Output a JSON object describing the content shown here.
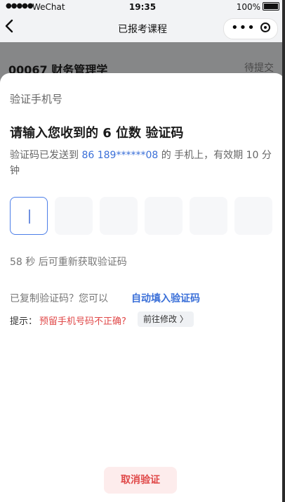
{
  "statusbar": {
    "signal": "●●●●●",
    "carrier": "WeChat",
    "time": "19:35",
    "battery": "100%"
  },
  "navbar": {
    "title": "已报考课程",
    "back_icon": "chevron-left-icon",
    "more_icon": "ellipsis-icon",
    "close_icon": "target-circle-icon"
  },
  "background": {
    "course_title": "00067 财务管理学",
    "status": "待提交"
  },
  "sheet": {
    "title": "验证手机号",
    "heading": "请输入您收到的 6 位数 验证码",
    "sent_prefix": "验证码已发送到 ",
    "phone": "86 189******08",
    "sent_suffix": " 的 手机上，有效期 10 分钟",
    "code_length": 6,
    "resend_text": "58 秒 后可重新获取验证码",
    "copied_text": "已复制验证码？您可以",
    "autofill_text": "自动填入验证码",
    "tip_label": "提示：",
    "tip_warning": "预留手机号码不正确?",
    "tip_button": "前往修改 〉",
    "cancel_button": "取消验证"
  },
  "colors": {
    "accent": "#3a6fd8",
    "danger": "#e04848",
    "cancel_bg": "#fdecec"
  }
}
